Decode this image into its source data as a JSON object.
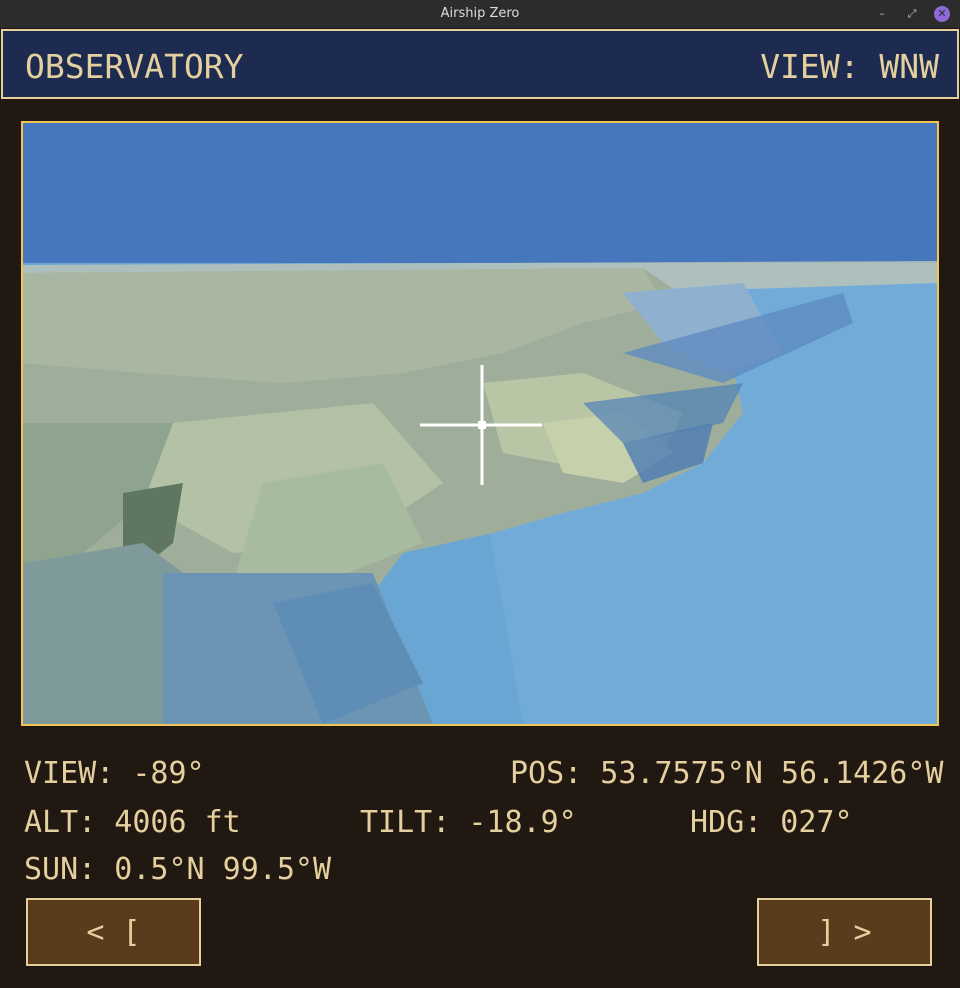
{
  "window": {
    "title": "Airship Zero",
    "minimize_glyph": "–",
    "restore_glyph": "⤢",
    "close_glyph": "✕"
  },
  "header": {
    "title": "OBSERVATORY",
    "view_direction": "VIEW: WNW"
  },
  "readouts": {
    "view": "VIEW: -89°",
    "pos": "POS: 53.7575°N 56.1426°W",
    "alt": "ALT: 4006 ft",
    "tilt": "TILT: -18.9°",
    "hdg": "HDG: 027°",
    "sun": "SUN: 0.5°N 99.5°W"
  },
  "buttons": {
    "prev": "< [",
    "next": "] >"
  },
  "colors": {
    "sky": "#4677bd",
    "water": "#6aa6d4",
    "land": "#9fae9a",
    "accent_border": "#f0c455",
    "text": "#e4cf9e"
  }
}
